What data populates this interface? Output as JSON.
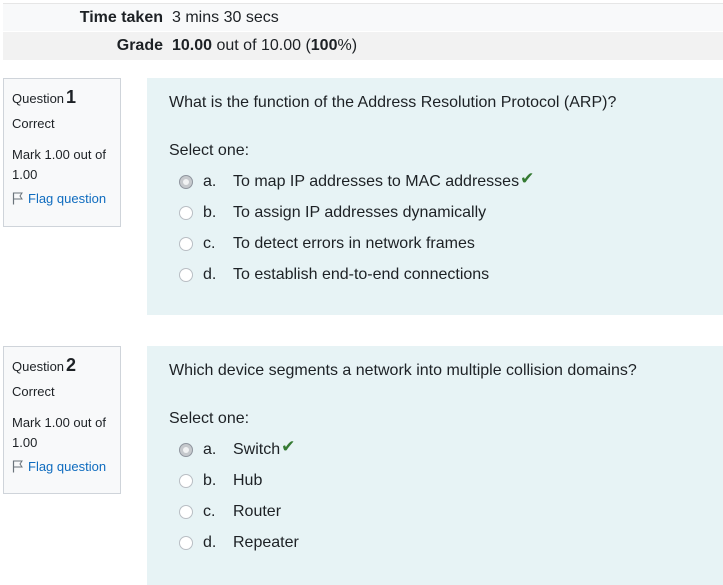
{
  "summary": {
    "time_taken_label": "Time taken",
    "time_taken_value": "3 mins 30 secs",
    "grade_label": "Grade",
    "grade_score": "10.00",
    "grade_mid": " out of 10.00 (",
    "grade_percent": "100",
    "grade_end": "%)"
  },
  "questions": [
    {
      "label": "Question",
      "number": "1",
      "state": "Correct",
      "mark": "Mark 1.00 out of 1.00",
      "flag_label": "Flag question",
      "text": "What is the function of the Address Resolution Protocol (ARP)?",
      "prompt": "Select one:",
      "answers": [
        {
          "letter": "a.",
          "text": "To map IP addresses to MAC addresses",
          "selected": true,
          "correct": true
        },
        {
          "letter": "b.",
          "text": "To assign IP addresses dynamically",
          "selected": false,
          "correct": false
        },
        {
          "letter": "c.",
          "text": "To detect errors in network frames",
          "selected": false,
          "correct": false
        },
        {
          "letter": "d.",
          "text": "To establish end-to-end connections",
          "selected": false,
          "correct": false
        }
      ]
    },
    {
      "label": "Question",
      "number": "2",
      "state": "Correct",
      "mark": "Mark 1.00 out of 1.00",
      "flag_label": "Flag question",
      "text": "Which device segments a network into multiple collision domains?",
      "prompt": "Select one:",
      "answers": [
        {
          "letter": "a.",
          "text": "Switch",
          "selected": true,
          "correct": true
        },
        {
          "letter": "b.",
          "text": "Hub",
          "selected": false,
          "correct": false
        },
        {
          "letter": "c.",
          "text": "Router",
          "selected": false,
          "correct": false
        },
        {
          "letter": "d.",
          "text": "Repeater",
          "selected": false,
          "correct": false
        }
      ]
    }
  ],
  "icons": {
    "correct": "checkmark-icon",
    "flag": "flag-icon"
  },
  "colors": {
    "content_bg": "#e7f3f5",
    "info_bg": "#f8f9fa",
    "link": "#0f6cbf",
    "correct": "#357a32"
  }
}
